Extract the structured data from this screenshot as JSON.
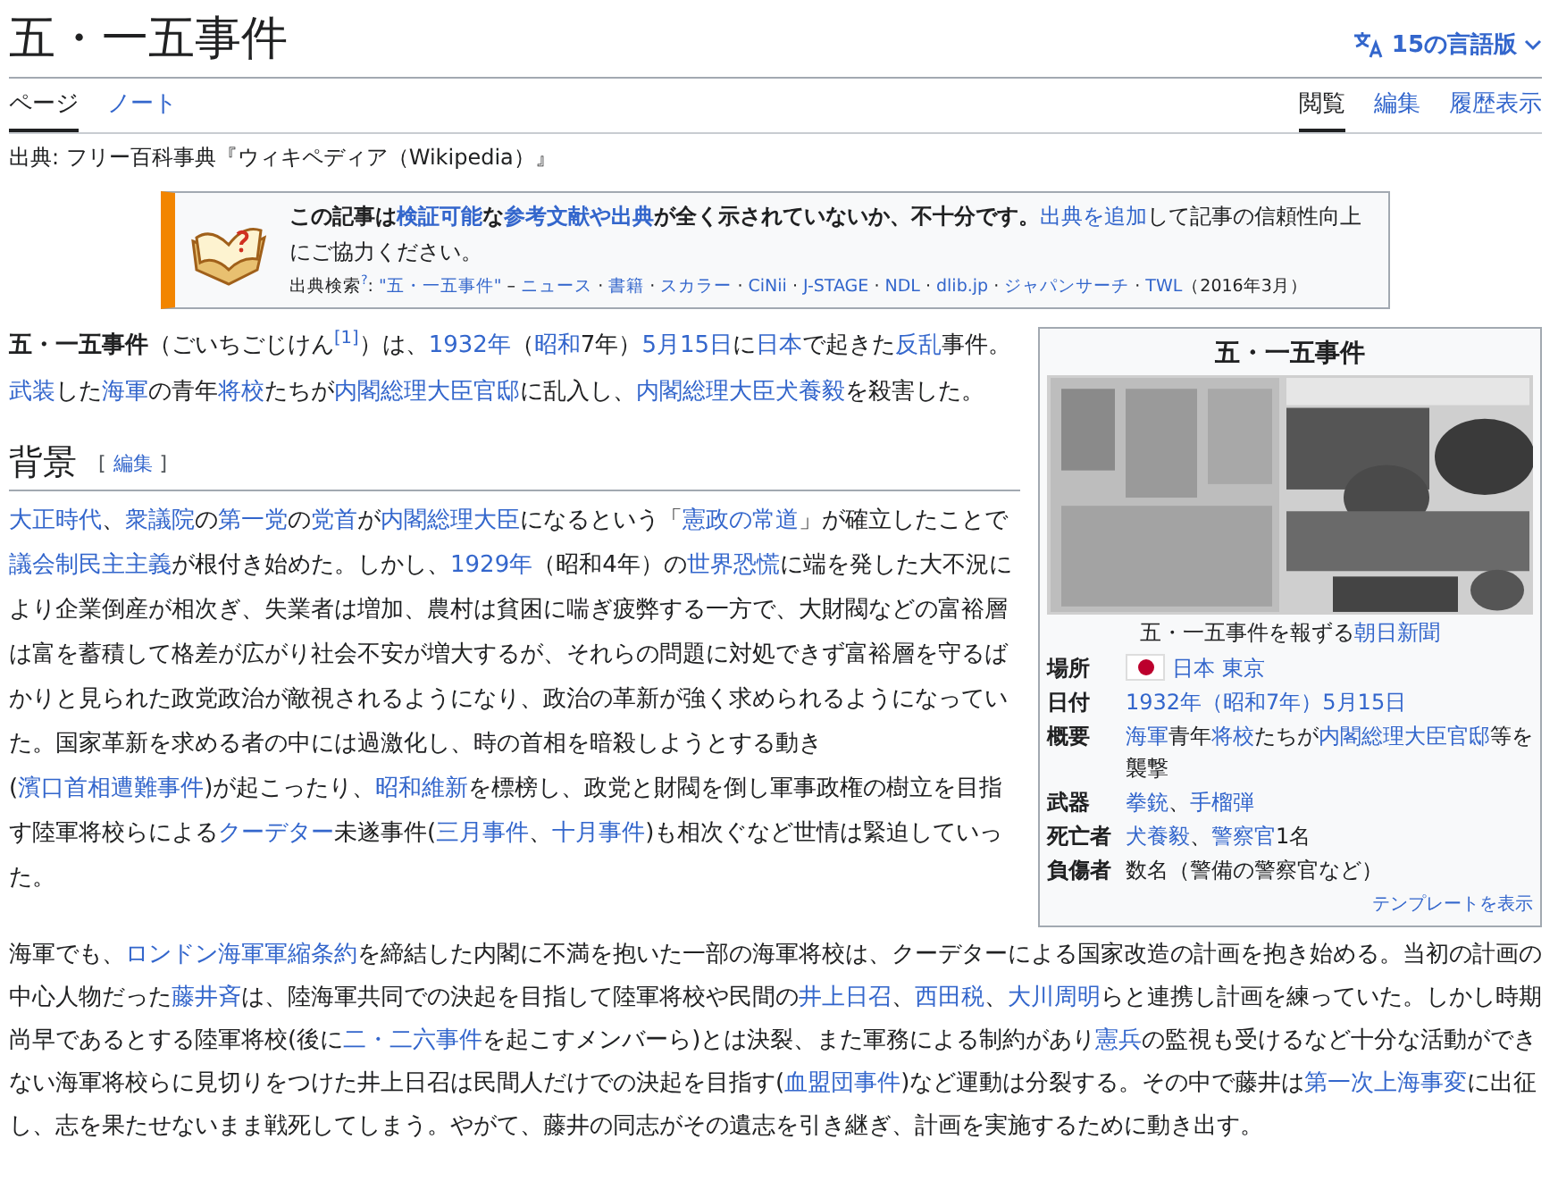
{
  "title": "五・一五事件",
  "language_button": "15の言語版",
  "tabs_left": [
    {
      "label": "ページ",
      "selected": true
    },
    {
      "label": "ノート",
      "selected": false
    }
  ],
  "tabs_right": [
    {
      "label": "閲覧",
      "selected": true
    },
    {
      "label": "編集",
      "selected": false
    },
    {
      "label": "履歴表示",
      "selected": false
    }
  ],
  "source_line": "出典: フリー百科事典『ウィキペディア（Wikipedia）』",
  "notice": {
    "lines": [
      [
        {
          "text": "**この記事は**",
          "kind": "text"
        },
        {
          "text": "**検証可能**",
          "kind": "link"
        },
        {
          "text": "**な**",
          "kind": "text"
        },
        {
          "text": "**参考文献や出典**",
          "kind": "link"
        },
        {
          "text": "**が全く示されていないか、不十分です。**",
          "kind": "text"
        },
        {
          "text": "出典を追加",
          "kind": "link"
        },
        {
          "text": "して記事の信頼性向上にご協力ください。",
          "kind": "text"
        }
      ],
      [
        {
          "text": "出典検索",
          "kind": "text"
        },
        {
          "text": "$^{?}$",
          "kind": "link"
        },
        {
          "text": ": ",
          "kind": "text"
        },
        {
          "text": "\"五・一五事件\"",
          "kind": "link"
        },
        {
          "text": " – ",
          "kind": "text"
        },
        {
          "text": "ニュース",
          "kind": "link"
        },
        {
          "text": " · ",
          "kind": "text"
        },
        {
          "text": "書籍",
          "kind": "link"
        },
        {
          "text": " · ",
          "kind": "text"
        },
        {
          "text": "スカラー",
          "kind": "link"
        },
        {
          "text": " · ",
          "kind": "text"
        },
        {
          "text": "CiNii",
          "kind": "link"
        },
        {
          "text": " · ",
          "kind": "text"
        },
        {
          "text": "J-STAGE",
          "kind": "link"
        },
        {
          "text": " · ",
          "kind": "text"
        },
        {
          "text": "NDL",
          "kind": "link"
        },
        {
          "text": " · ",
          "kind": "text"
        },
        {
          "text": "dlib.jp",
          "kind": "link"
        },
        {
          "text": " · ",
          "kind": "text"
        },
        {
          "text": "ジャパンサーチ",
          "kind": "link"
        },
        {
          "text": " · ",
          "kind": "text"
        },
        {
          "text": "TWL",
          "kind": "link"
        },
        {
          "text": "（2016年3月）",
          "kind": "text"
        }
      ]
    ]
  },
  "infobox": {
    "title": "五・一五事件",
    "caption": [
      {
        "text": "五・一五事件を報ずる",
        "kind": "text"
      },
      {
        "text": "朝日新聞",
        "kind": "link"
      }
    ],
    "rows": [
      {
        "label": "場所",
        "flag": true,
        "value": [
          {
            "text": "日本",
            "kind": "link"
          },
          {
            "text": "東京",
            "kind": "link"
          }
        ]
      },
      {
        "label": "日付",
        "flag": false,
        "value": [
          {
            "text": "1932年（昭和7年）5月15日",
            "kind": "link"
          }
        ]
      },
      {
        "label": "概要",
        "flag": false,
        "value": [
          {
            "text": "海軍",
            "kind": "link"
          },
          {
            "text": "青年",
            "kind": "text"
          },
          {
            "text": "将校",
            "kind": "link"
          },
          {
            "text": "たちが",
            "kind": "text"
          },
          {
            "text": "内閣総理大臣官邸",
            "kind": "link"
          },
          {
            "text": "等を襲撃",
            "kind": "text"
          }
        ]
      },
      {
        "label": "武器",
        "flag": false,
        "value": [
          {
            "text": "拳銃",
            "kind": "link"
          },
          {
            "text": "、",
            "kind": "text"
          },
          {
            "text": "手榴弾",
            "kind": "link"
          }
        ]
      },
      {
        "label": "死亡者",
        "flag": false,
        "value": [
          {
            "text": "犬養毅",
            "kind": "link"
          },
          {
            "text": "、",
            "kind": "text"
          },
          {
            "text": "警察官",
            "kind": "link"
          },
          {
            "text": "1名",
            "kind": "text"
          }
        ]
      },
      {
        "label": "負傷者",
        "flag": false,
        "value": [
          {
            "text": "数名（警備の警察官など）",
            "kind": "text"
          }
        ]
      }
    ],
    "footer": "テンプレートを表示"
  },
  "lead": [
    {
      "text": "**五・一五事件**（ごいちごじけん",
      "kind": "text"
    },
    {
      "text": "$^{[1]}$",
      "kind": "link"
    },
    {
      "text": "）は、",
      "kind": "text"
    },
    {
      "text": "1932年",
      "kind": "link"
    },
    {
      "text": "（",
      "kind": "text"
    },
    {
      "text": "昭和",
      "kind": "link"
    },
    {
      "text": "7年）",
      "kind": "text"
    },
    {
      "text": "5月15日",
      "kind": "link"
    },
    {
      "text": "に",
      "kind": "text"
    },
    {
      "text": "日本",
      "kind": "link"
    },
    {
      "text": "で起きた",
      "kind": "text"
    },
    {
      "text": "反乱",
      "kind": "link"
    },
    {
      "text": "事件。",
      "kind": "text"
    },
    {
      "text": "武装",
      "kind": "link"
    },
    {
      "text": "した",
      "kind": "text"
    },
    {
      "text": "海軍",
      "kind": "link"
    },
    {
      "text": "の青年",
      "kind": "text"
    },
    {
      "text": "将校",
      "kind": "link"
    },
    {
      "text": "たちが",
      "kind": "text"
    },
    {
      "text": "内閣総理大臣官邸",
      "kind": "link"
    },
    {
      "text": "に乱入し、",
      "kind": "text"
    },
    {
      "text": "内閣総理大臣犬養毅",
      "kind": "link"
    },
    {
      "text": "を殺害した。",
      "kind": "text"
    }
  ],
  "section": {
    "heading": "背景",
    "edit_label": "編集",
    "edit_brackets": [
      "[",
      "]"
    ],
    "paragraphs": [
      [
        {
          "text": "大正時代",
          "kind": "link"
        },
        {
          "text": "、",
          "kind": "text"
        },
        {
          "text": "衆議院",
          "kind": "link"
        },
        {
          "text": "の",
          "kind": "text"
        },
        {
          "text": "第一党",
          "kind": "link"
        },
        {
          "text": "の",
          "kind": "text"
        },
        {
          "text": "党首",
          "kind": "link"
        },
        {
          "text": "が",
          "kind": "text"
        },
        {
          "text": "内閣総理大臣",
          "kind": "link"
        },
        {
          "text": "になるという「",
          "kind": "text"
        },
        {
          "text": "憲政の常道",
          "kind": "link"
        },
        {
          "text": "」が確立したことで",
          "kind": "text"
        },
        {
          "text": "議会制民主主義",
          "kind": "link"
        },
        {
          "text": "が根付き始めた。しかし、",
          "kind": "text"
        },
        {
          "text": "1929年",
          "kind": "link"
        },
        {
          "text": "（昭和4年）の",
          "kind": "text"
        },
        {
          "text": "世界恐慌",
          "kind": "link"
        },
        {
          "text": "に端を発した大不況により企業倒産が相次ぎ、失業者は増加、農村は貧困に喘ぎ疲弊する一方で、大財閥などの富裕層は富を蓄積して格差が広がり社会不安が増大するが、それらの問題に対処できず富裕層を守るばかりと見られた政党政治が敵視されるようになり、政治の革新が強く求められるようになっていた。国家革新を求める者の中には過激化し、時の首相を暗殺しようとする動き(",
          "kind": "text"
        },
        {
          "text": "濱口首相遭難事件",
          "kind": "link"
        },
        {
          "text": ")が起こったり、",
          "kind": "text"
        },
        {
          "text": "昭和維新",
          "kind": "link"
        },
        {
          "text": "を標榜し、政党と財閥を倒し軍事政権の樹立を目指す陸軍将校らによる",
          "kind": "text"
        },
        {
          "text": "クーデター",
          "kind": "link"
        },
        {
          "text": "未遂事件(",
          "kind": "text"
        },
        {
          "text": "三月事件",
          "kind": "link"
        },
        {
          "text": "、",
          "kind": "text"
        },
        {
          "text": "十月事件",
          "kind": "link"
        },
        {
          "text": ")も相次ぐなど世情は緊迫していった。",
          "kind": "text"
        }
      ],
      [
        {
          "text": "海軍でも、",
          "kind": "text"
        },
        {
          "text": "ロンドン海軍軍縮条約",
          "kind": "link"
        },
        {
          "text": "を締結した内閣に不満を抱いた一部の海軍将校は、クーデターによる国家改造の計画を抱き始める。当初の計画の中心人物だった",
          "kind": "text"
        },
        {
          "text": "藤井斉",
          "kind": "link"
        },
        {
          "text": "は、陸海軍共同での決起を目指して陸軍将校や民間の",
          "kind": "text"
        },
        {
          "text": "井上日召",
          "kind": "link"
        },
        {
          "text": "、",
          "kind": "text"
        },
        {
          "text": "西田税",
          "kind": "link"
        },
        {
          "text": "、",
          "kind": "text"
        },
        {
          "text": "大川周明",
          "kind": "link"
        },
        {
          "text": "らと連携し計画を練っていた。しかし時期尚早であるとする陸軍将校(後に",
          "kind": "text"
        },
        {
          "text": "二・二六事件",
          "kind": "link"
        },
        {
          "text": "を起こすメンバーら)とは決裂、また軍務による制約があり",
          "kind": "text"
        },
        {
          "text": "憲兵",
          "kind": "link"
        },
        {
          "text": "の監視も受けるなど十分な活動ができない海軍将校らに見切りをつけた井上日召は民間人だけでの決起を目指す(",
          "kind": "text"
        },
        {
          "text": "血盟団事件",
          "kind": "link"
        },
        {
          "text": ")など運動は分裂する。その中で藤井は",
          "kind": "text"
        },
        {
          "text": "第一次上海事変",
          "kind": "link"
        },
        {
          "text": "に出征し、志を果たせないまま戦死してしまう。やがて、藤井の同志がその遺志を引き継ぎ、計画を実施するために動き出す。",
          "kind": "text"
        }
      ]
    ]
  }
}
